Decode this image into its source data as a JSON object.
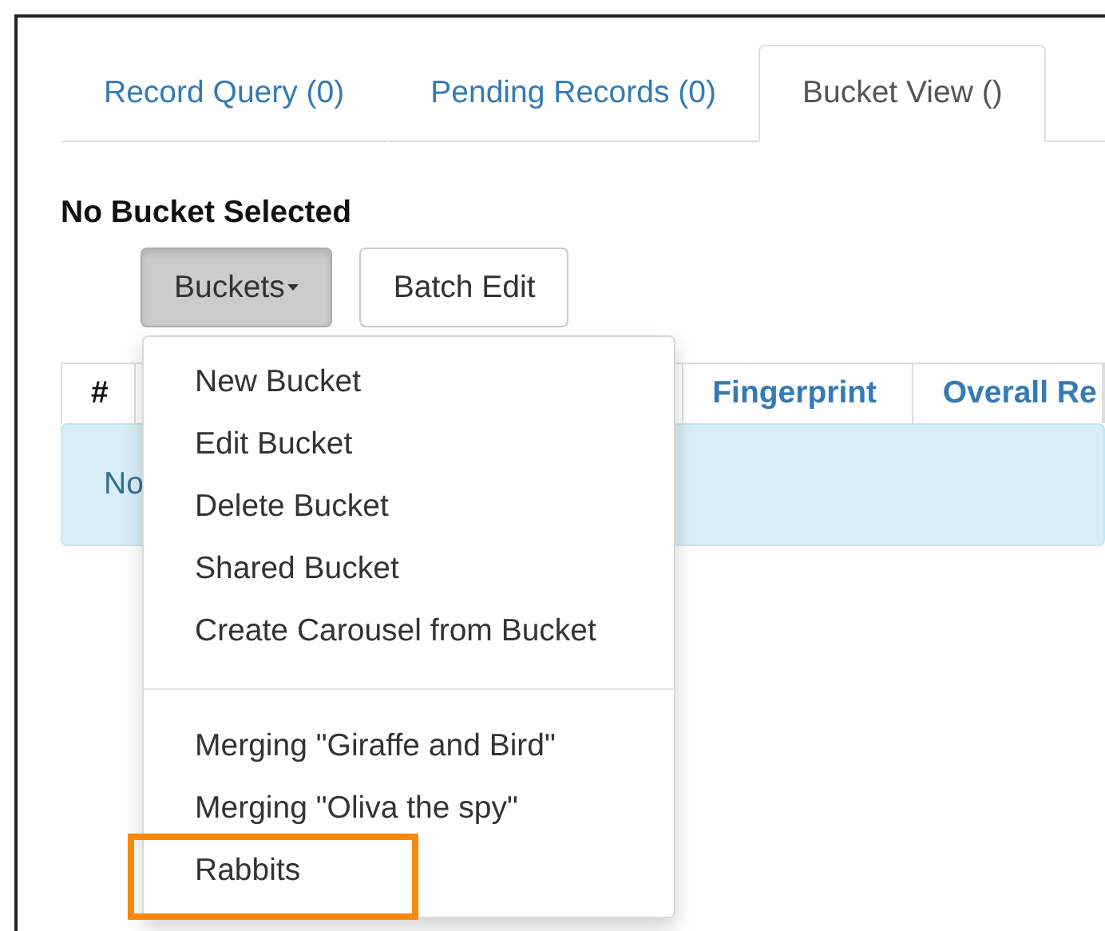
{
  "tabs": [
    {
      "label": "Record Query (0)",
      "selected": false
    },
    {
      "label": "Pending Records (0)",
      "selected": false
    },
    {
      "label": "Bucket View ()",
      "selected": true
    }
  ],
  "heading": "No Bucket Selected",
  "buttons": [
    {
      "label": "Buckets",
      "kind": "dropdown",
      "open": true
    },
    {
      "label": "Batch Edit",
      "kind": "plain",
      "open": false
    }
  ],
  "table": {
    "columns": [
      "#",
      "",
      "Fingerprint",
      "Overall Re"
    ],
    "empty_message": "No"
  },
  "menu": {
    "items": [
      {
        "label": "New Bucket",
        "kind": "item",
        "highlighted": false
      },
      {
        "label": "Edit Bucket",
        "kind": "item",
        "highlighted": false
      },
      {
        "label": "Delete Bucket",
        "kind": "item",
        "highlighted": false
      },
      {
        "label": "Shared Bucket",
        "kind": "item",
        "highlighted": false
      },
      {
        "label": "Create Carousel from Bucket",
        "kind": "item",
        "highlighted": false
      },
      {
        "kind": "divider"
      },
      {
        "label": "Merging \"Giraffe and Bird\"",
        "kind": "item",
        "highlighted": false
      },
      {
        "label": "Merging \"Oliva the spy\"",
        "kind": "item",
        "highlighted": false
      },
      {
        "label": "Rabbits",
        "kind": "item",
        "highlighted": true
      }
    ]
  }
}
